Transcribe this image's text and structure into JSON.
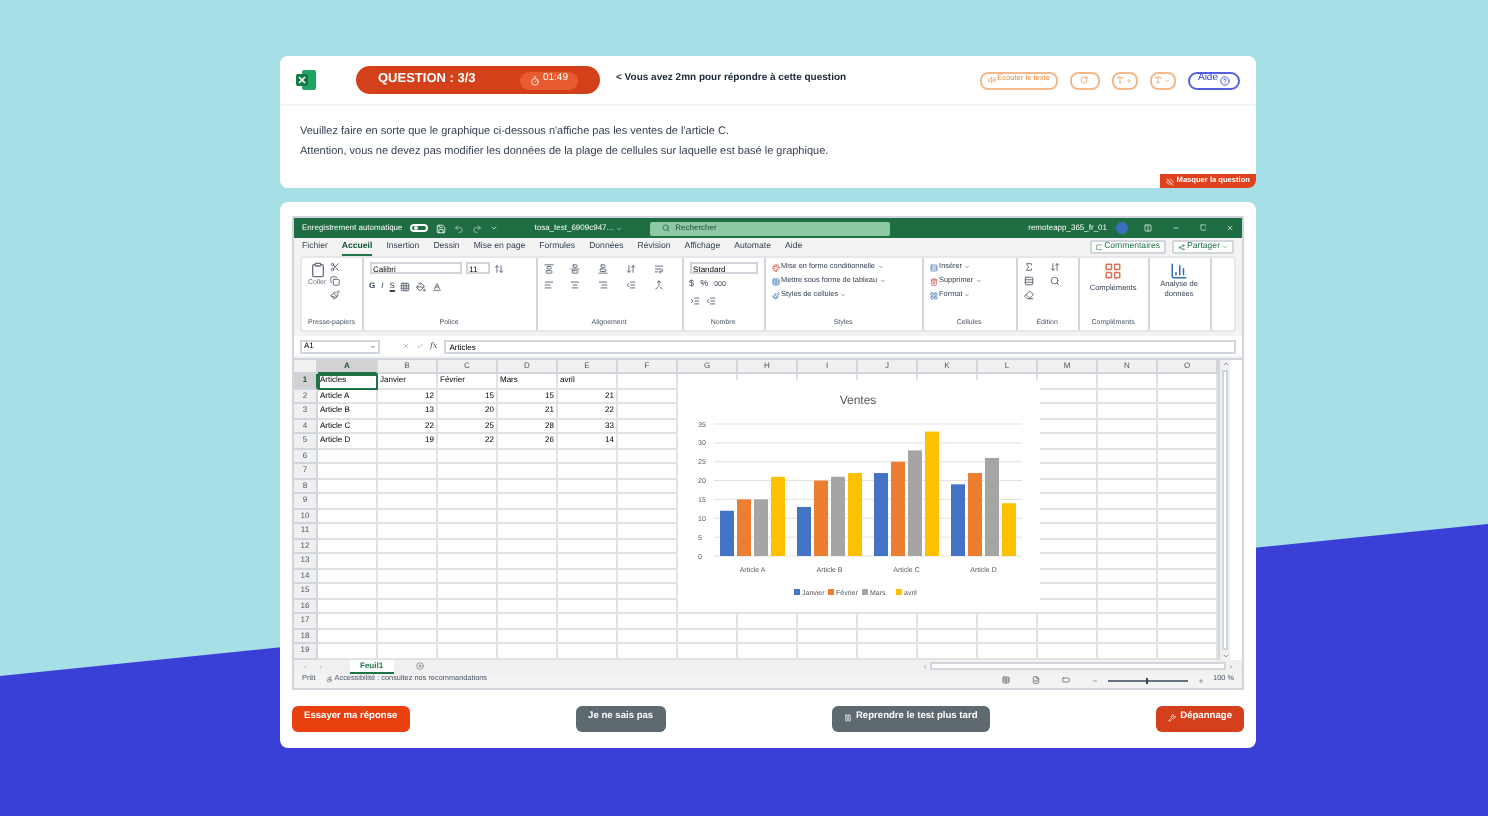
{
  "header": {
    "question": "QUESTION : 3/3",
    "timer": "01:49",
    "notice": "< Vous avez 2mn pour répondre à cette question",
    "listen_button": "Écouter le texte",
    "help_button": "Aide"
  },
  "instructions": [
    "Veuillez faire en sorte que le graphique ci-dessous n'affiche pas les ventes de l'article C.",
    "Attention, vous ne devez pas modifier les données de la plage de cellules sur laquelle est basé le graphique."
  ],
  "hide_button": "Masquer la question",
  "excel": {
    "autosave": {
      "label": "Enregistrement automatique",
      "on": false
    },
    "filename": "tosa_test_6909c947...",
    "search_placeholder": "Rechercher",
    "user": "remoteapp_365_fr_01",
    "tabs": [
      {
        "label": "Fichier",
        "selected": false
      },
      {
        "label": "Accueil",
        "selected": true
      },
      {
        "label": "Insertion",
        "selected": false
      },
      {
        "label": "Dessin",
        "selected": false
      },
      {
        "label": "Mise en page",
        "selected": false
      },
      {
        "label": "Formules",
        "selected": false
      },
      {
        "label": "Données",
        "selected": false
      },
      {
        "label": "Révision",
        "selected": false
      },
      {
        "label": "Affichage",
        "selected": false
      },
      {
        "label": "Automate",
        "selected": false
      },
      {
        "label": "Aide",
        "selected": false
      }
    ],
    "comments_button": "Commentaires",
    "share_button": "Partager",
    "ribbon": [
      {
        "kind": "clipboard",
        "label": "Presse-papiers",
        "paste": "Coller"
      },
      {
        "kind": "font",
        "label": "Police",
        "font": "Calibri",
        "size": "11",
        "bold": "G",
        "italic": "I",
        "underline": "S"
      },
      {
        "kind": "alignment",
        "label": "Alignement"
      },
      {
        "kind": "number",
        "label": "Nombre",
        "format": "Standard",
        "currency": "$",
        "percent": "%",
        "thousands": "000"
      },
      {
        "kind": "styles",
        "label": "Styles",
        "items": [
          "Mise en forme conditionnelle",
          "Mettre sous forme de tableau",
          "Styles de cellules"
        ]
      },
      {
        "kind": "cells",
        "label": "Cellules",
        "items": [
          "Insérer",
          "Supprimer",
          "Format"
        ]
      },
      {
        "kind": "editing",
        "label": "Édition"
      },
      {
        "kind": "addins",
        "label": "Compléments",
        "button": "Compléments"
      },
      {
        "kind": "analysis",
        "button": "Analyse de données"
      }
    ],
    "name_box": "A1",
    "function_label": "fx",
    "formula": "Articles",
    "columns": [
      {
        "label": "A",
        "selected": true
      },
      {
        "label": "B",
        "selected": false
      },
      {
        "label": "C",
        "selected": false
      },
      {
        "label": "D",
        "selected": false
      },
      {
        "label": "E",
        "selected": false
      },
      {
        "label": "F",
        "selected": false
      },
      {
        "label": "G",
        "selected": false
      },
      {
        "label": "H",
        "selected": false
      },
      {
        "label": "I",
        "selected": false
      },
      {
        "label": "J",
        "selected": false
      },
      {
        "label": "K",
        "selected": false
      },
      {
        "label": "L",
        "selected": false
      },
      {
        "label": "M",
        "selected": false
      },
      {
        "label": "N",
        "selected": false
      },
      {
        "label": "O",
        "selected": false
      }
    ],
    "rows": [
      {
        "number": "1",
        "selected": true,
        "cells": [
          "Articles",
          "Janvier",
          "Février",
          "Mars",
          "avril"
        ]
      },
      {
        "number": "2",
        "selected": false,
        "cells": [
          "Article A",
          "12",
          "15",
          "15",
          "21"
        ]
      },
      {
        "number": "3",
        "selected": false,
        "cells": [
          "Article B",
          "13",
          "20",
          "21",
          "22"
        ]
      },
      {
        "number": "4",
        "selected": false,
        "cells": [
          "Article C",
          "22",
          "25",
          "28",
          "33"
        ]
      },
      {
        "number": "5",
        "selected": false,
        "cells": [
          "Article D",
          "19",
          "22",
          "26",
          "14"
        ]
      },
      {
        "number": "6",
        "selected": false
      },
      {
        "number": "7",
        "selected": false
      },
      {
        "number": "8",
        "selected": false
      },
      {
        "number": "9",
        "selected": false
      },
      {
        "number": "10",
        "selected": false
      },
      {
        "number": "11",
        "selected": false
      },
      {
        "number": "12",
        "selected": false
      },
      {
        "number": "13",
        "selected": false
      },
      {
        "number": "14",
        "selected": false
      },
      {
        "number": "15",
        "selected": false
      },
      {
        "number": "16",
        "selected": false
      },
      {
        "number": "17",
        "selected": false
      },
      {
        "number": "18",
        "selected": false
      },
      {
        "number": "19",
        "selected": false
      }
    ],
    "chart_data": {
      "type": "bar",
      "title": "Ventes",
      "grid": true,
      "legend": "bottom",
      "categories": [
        "Article A",
        "Article B",
        "Article C",
        "Article D"
      ],
      "ylim": [
        0,
        35
      ],
      "yticks": [
        0,
        5,
        10,
        15,
        20,
        25,
        30,
        35
      ],
      "series": [
        {
          "name": "Janvier",
          "color": "#4472c4",
          "values": [
            12,
            13,
            22,
            19
          ]
        },
        {
          "name": "Février",
          "color": "#ed7d31",
          "values": [
            15,
            20,
            25,
            22
          ]
        },
        {
          "name": "Mars",
          "color": "#a5a5a5",
          "values": [
            15,
            21,
            28,
            26
          ]
        },
        {
          "name": "avril",
          "color": "#ffc000",
          "values": [
            21,
            22,
            33,
            14
          ]
        }
      ]
    },
    "sheets": [
      {
        "label": "Feuil1",
        "selected": true
      }
    ],
    "status": {
      "ready": "Prêt",
      "accessibility": "Accessibilité : consultez nos recommandations",
      "zoom": "100 %",
      "zoom_slider": {
        "level": 0.5
      }
    }
  },
  "footer": [
    {
      "kind": "primary",
      "label": "Essayer ma réponse"
    },
    {
      "kind": "neutral",
      "label": "Je ne sais pas"
    },
    {
      "kind": "pause",
      "label": "Reprendre le test plus tard"
    },
    {
      "kind": "danger",
      "label": "Dépannage"
    }
  ]
}
